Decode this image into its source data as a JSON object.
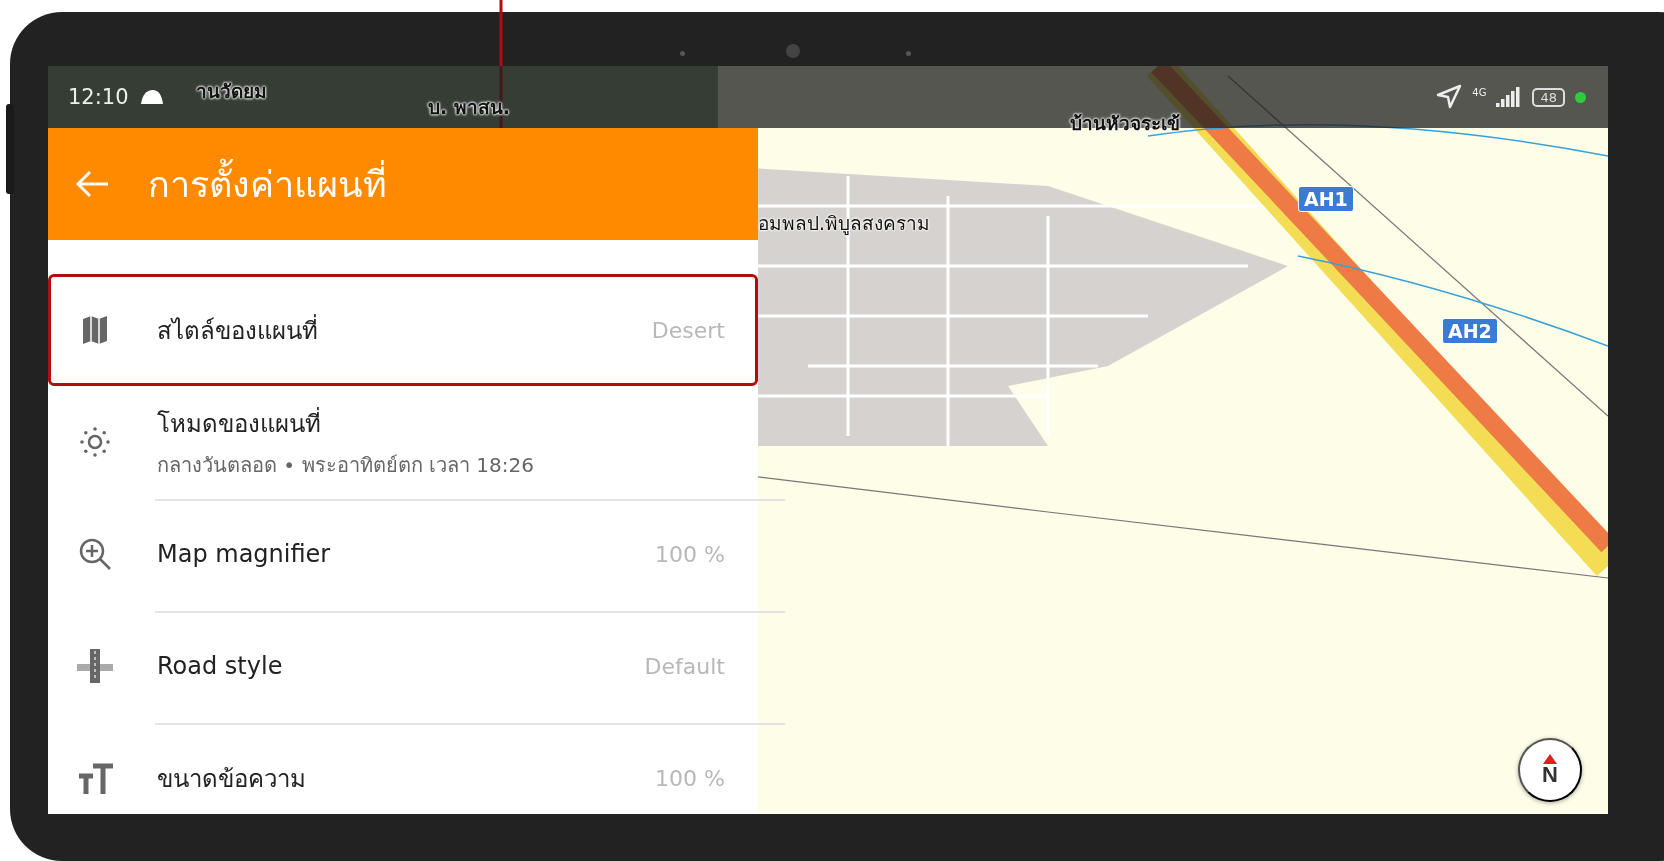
{
  "status_bar": {
    "time": "12:10",
    "network": "4G",
    "battery": "48"
  },
  "header": {
    "title": "การตั้งค่าแผนที่"
  },
  "settings": [
    {
      "label": "สไตล์ของแผนที่",
      "value": "Desert",
      "selected": true
    },
    {
      "label": "โหมดของแผนที่",
      "subtitle": "กลางวันตลอด • พระอาทิตย์ตก เวลา 18:26",
      "selected": false
    },
    {
      "label": "Map magnifier",
      "value": "100 %",
      "selected": false
    },
    {
      "label": "Road style",
      "value": "Default",
      "selected": false
    },
    {
      "label": "ขนาดข้อความ",
      "value": "100 %",
      "selected": false
    }
  ],
  "map": {
    "labels": [
      "านวัดยม",
      "บ. พาสน.",
      "บ้านหัวจระเข้",
      "อมพลป.พิบูลสงคราม"
    ],
    "shields": [
      "AH1",
      "AH2"
    ],
    "compass": "N"
  }
}
